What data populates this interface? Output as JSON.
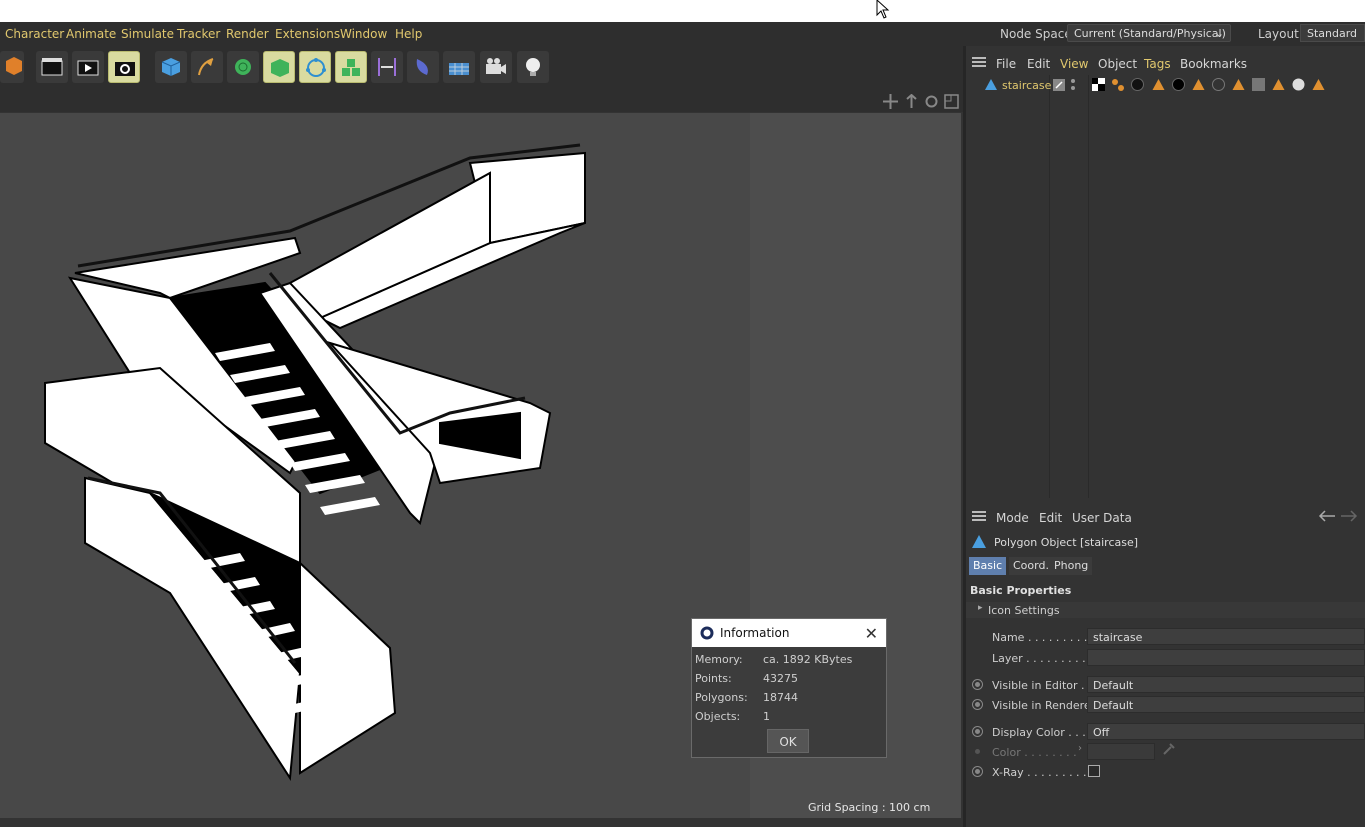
{
  "menubar": {
    "items": [
      "Character",
      "Animate",
      "Simulate",
      "Tracker",
      "Render",
      "Extensions",
      "Window",
      "Help"
    ],
    "node_space_label": "Node Space:",
    "node_space_value": "Current (Standard/Physical)",
    "layout_label": "Layout:",
    "layout_value": "Standard"
  },
  "toolbar": {
    "icons": [
      "cube-primitive-icon",
      "render-region-icon",
      "render-view-icon",
      "render-settings-icon",
      "cube-icon",
      "pen-spline-icon",
      "subdivision-icon",
      "extrude-icon",
      "mograph-cloner-icon",
      "array-icon",
      "symmetry-icon",
      "deformer-icon",
      "floor-icon",
      "camera-icon",
      "light-icon"
    ]
  },
  "viewport": {
    "grid_spacing": "Grid Spacing : 100 cm"
  },
  "dialog": {
    "title": "Information",
    "rows": [
      {
        "label": "Memory:",
        "value": "ca. 1892 KBytes"
      },
      {
        "label": "Points:",
        "value": "43275"
      },
      {
        "label": "Polygons:",
        "value": "18744"
      },
      {
        "label": "Objects:",
        "value": "1"
      }
    ],
    "ok_label": "OK"
  },
  "object_manager": {
    "menu": [
      "File",
      "Edit",
      "View",
      "Object",
      "Tags",
      "Bookmarks"
    ],
    "object_name": "staircase"
  },
  "attribute_manager": {
    "menu": [
      "Mode",
      "Edit",
      "User Data"
    ],
    "object_title": "Polygon Object [staircase]",
    "tabs": [
      "Basic",
      "Coord.",
      "Phong"
    ],
    "section_title": "Basic Properties",
    "icon_settings": "Icon Settings",
    "fields": {
      "name_label": "Name . . . . . . . . . .",
      "name_value": "staircase",
      "layer_label": "Layer . . . . . . . . . .",
      "vis_editor_label": "Visible in Editor . .",
      "vis_editor_value": "Default",
      "vis_renderer_label": "Visible in Renderer",
      "vis_renderer_value": "Default",
      "display_color_label": "Display Color . . . .",
      "display_color_value": "Off",
      "color_label": "Color . . . . . . . .",
      "xray_label": "X-Ray . . . . . . . . ."
    }
  }
}
